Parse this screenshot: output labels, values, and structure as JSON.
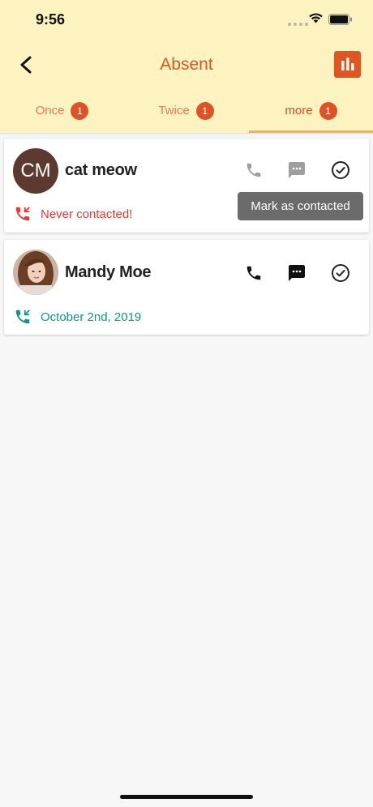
{
  "status_bar": {
    "time": "9:56"
  },
  "header": {
    "title": "Absent"
  },
  "tabs": [
    {
      "label": "Once",
      "badge": "1"
    },
    {
      "label": "Twice",
      "badge": "1"
    },
    {
      "label": "more",
      "badge": "1",
      "active": true
    }
  ],
  "contacts": [
    {
      "initials": "CM",
      "name": "cat meow",
      "status": "Never contacted!",
      "status_color": "#e53935"
    },
    {
      "name": "Mandy Moe",
      "status": "October 2nd, 2019",
      "status_color": "#109688"
    }
  ],
  "tooltip": {
    "text": "Mark as contacted"
  },
  "colors": {
    "header_bg": "#fdf3c0",
    "accent": "#de5420",
    "badge": "#df5224",
    "tab_indicator": "#f5b04a",
    "never_contacted": "#e53935",
    "contacted": "#109688"
  },
  "icons": [
    "back-arrow-icon",
    "bar-chart-icon",
    "phone-icon",
    "message-icon",
    "check-circle-icon",
    "phone-callback-icon"
  ]
}
